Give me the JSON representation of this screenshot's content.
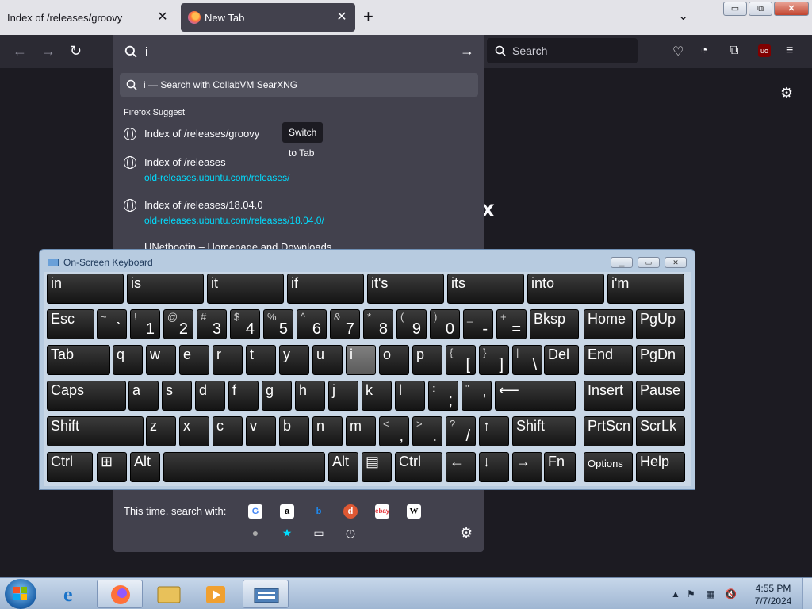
{
  "browser": {
    "tabs": [
      {
        "title": "Index of /releases/groovy",
        "active": false
      },
      {
        "title": "New Tab",
        "active": true
      }
    ],
    "window_buttons": {
      "minimize": "▭",
      "restore": "⧉",
      "close": "✕"
    },
    "search_placeholder": "Search"
  },
  "urlbar": {
    "value": "i",
    "search_suggestion": "i — Search with CollabVM SearXNG",
    "group_label": "Firefox Suggest",
    "results": [
      {
        "title": "Index of /releases/groovy",
        "url": "",
        "action": "Switch to Tab"
      },
      {
        "title": "Index of /releases",
        "url": "old-releases.ubuntu.com/releases/"
      },
      {
        "title": "Index of /releases/18.04.0",
        "url": "old-releases.ubuntu.com/releases/18.04.0/"
      },
      {
        "title": "UNetbootin – Homepage and Downloads",
        "url": ""
      }
    ],
    "search_with_label": "This time, search with:",
    "engines": [
      "google-icon",
      "amazon-icon",
      "bing-icon",
      "duckduckgo-icon",
      "ebay-icon",
      "wikipedia-icon"
    ],
    "modes": [
      "search-icon",
      "bookmarks-icon",
      "tabs-icon",
      "history-icon"
    ]
  },
  "page": {
    "partial_text": "x"
  },
  "osk": {
    "title": "On-Screen Keyboard",
    "predictions": [
      "in",
      "is",
      "it",
      "if",
      "it's",
      "its",
      "into",
      "i'm"
    ],
    "row_numbers": [
      {
        "top": "",
        "bot": "Esc"
      },
      {
        "top": "~",
        "bot": "`"
      },
      {
        "top": "!",
        "bot": "1"
      },
      {
        "top": "@",
        "bot": "2"
      },
      {
        "top": "#",
        "bot": "3"
      },
      {
        "top": "$",
        "bot": "4"
      },
      {
        "top": "%",
        "bot": "5"
      },
      {
        "top": "^",
        "bot": "6"
      },
      {
        "top": "&",
        "bot": "7"
      },
      {
        "top": "*",
        "bot": "8"
      },
      {
        "top": "(",
        "bot": "9"
      },
      {
        "top": ")",
        "bot": "0"
      },
      {
        "top": "_",
        "bot": "-"
      },
      {
        "top": "+",
        "bot": "="
      },
      {
        "top": "",
        "bot": "Bksp"
      }
    ],
    "row_q": [
      "Tab",
      "q",
      "w",
      "e",
      "r",
      "t",
      "y",
      "u",
      "i",
      "o",
      "p",
      "[",
      "]",
      "\\",
      "Del"
    ],
    "row_q_top": [
      "",
      "",
      "",
      "",
      "",
      "",
      "",
      "",
      "",
      "",
      "",
      "{",
      "}",
      "|",
      ""
    ],
    "row_a": [
      "Caps",
      "a",
      "s",
      "d",
      "f",
      "g",
      "h",
      "j",
      "k",
      "l",
      ";",
      "'",
      "⟵"
    ],
    "row_a_top": [
      "",
      "",
      "",
      "",
      "",
      "",
      "",
      "",
      "",
      "",
      ":",
      "\"",
      ""
    ],
    "row_z": [
      "Shift",
      "z",
      "x",
      "c",
      "v",
      "b",
      "n",
      "m",
      ",",
      ".",
      "/",
      "↑",
      "Shift"
    ],
    "row_z_top": [
      "",
      "",
      "",
      "",
      "",
      "",
      "",
      "",
      "<",
      ">",
      "?",
      "",
      ""
    ],
    "row_bottom": [
      "Ctrl",
      "⊞",
      "Alt",
      "",
      "Alt",
      "▤",
      "Ctrl",
      "←",
      "↓",
      "→",
      "Fn"
    ],
    "nav_keys": [
      [
        "Home",
        "PgUp"
      ],
      [
        "End",
        "PgDn"
      ],
      [
        "Insert",
        "Pause"
      ],
      [
        "PrtScn",
        "ScrLk"
      ],
      [
        "Options",
        "Help"
      ]
    ]
  },
  "taskbar": {
    "time": "4:55 PM",
    "date": "7/7/2024"
  }
}
